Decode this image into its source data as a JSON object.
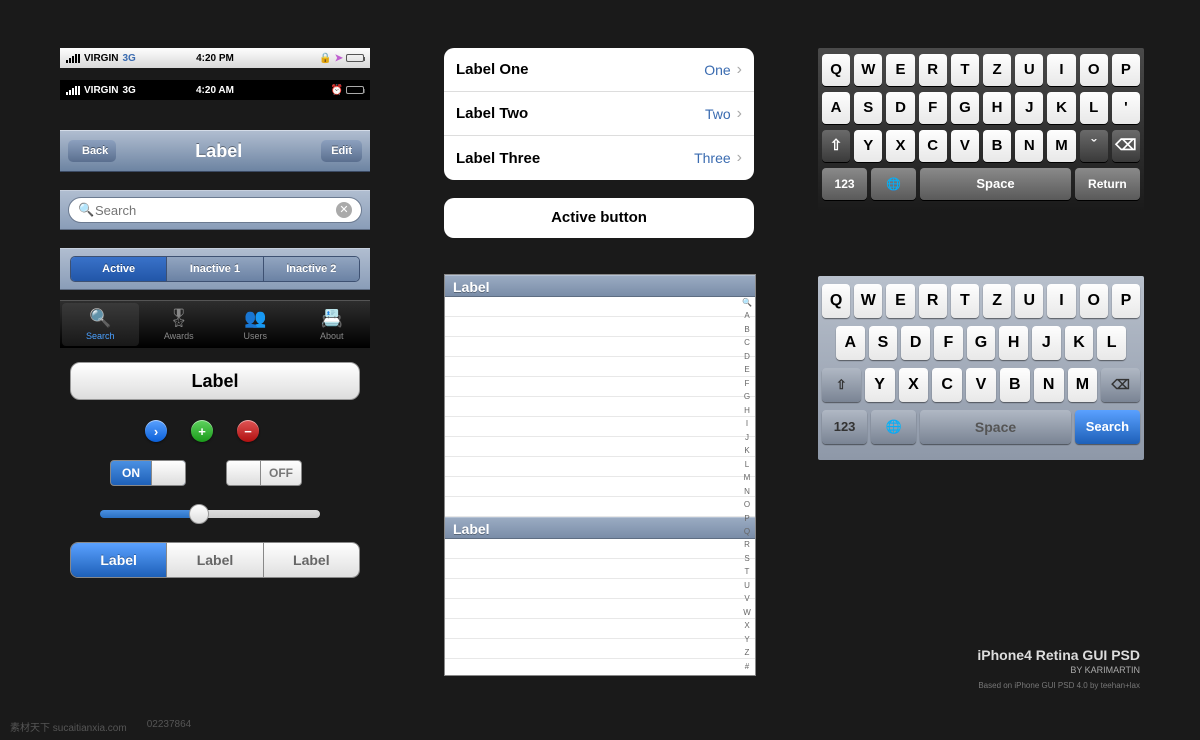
{
  "status_light": {
    "carrier": "VIRGIN",
    "network": "3G",
    "time": "4:20 PM"
  },
  "status_dark": {
    "carrier": "VIRGIN",
    "network": "3G",
    "time": "4:20 AM"
  },
  "navbar": {
    "back": "Back",
    "title": "Label",
    "edit": "Edit"
  },
  "search": {
    "placeholder": "Search"
  },
  "segmented_blue": {
    "active": "Active",
    "inactive1": "Inactive 1",
    "inactive2": "Inactive 2"
  },
  "tabbar": {
    "search": "Search",
    "awards": "Awards",
    "users": "Users",
    "about": "About"
  },
  "bigbutton": "Label",
  "toggle_on": "ON",
  "toggle_off": "OFF",
  "seg_gray": {
    "a": "Label",
    "b": "Label",
    "c": "Label"
  },
  "table": [
    {
      "label": "Label One",
      "value": "One"
    },
    {
      "label": "Label Two",
      "value": "Two"
    },
    {
      "label": "Label Three",
      "value": "Three"
    }
  ],
  "active_button": "Active button",
  "tableview": {
    "header1": "Label",
    "header2": "Label",
    "index": [
      "🔍",
      "A",
      "B",
      "C",
      "D",
      "E",
      "F",
      "G",
      "H",
      "I",
      "J",
      "K",
      "L",
      "M",
      "N",
      "O",
      "P",
      "Q",
      "R",
      "S",
      "T",
      "U",
      "V",
      "W",
      "X",
      "Y",
      "Z",
      "#"
    ]
  },
  "kb_dark": {
    "row1": [
      "Q",
      "W",
      "E",
      "R",
      "T",
      "Z",
      "U",
      "I",
      "O",
      "P"
    ],
    "row2": [
      "A",
      "S",
      "D",
      "F",
      "G",
      "H",
      "J",
      "K",
      "L",
      "'"
    ],
    "row3": [
      "⇧",
      "Y",
      "X",
      "C",
      "V",
      "B",
      "N",
      "M",
      "ˇ",
      "⌫"
    ],
    "row4": {
      "num": "123",
      "globe": "🌐",
      "space": "Space",
      "ret": "Return"
    }
  },
  "kb_light": {
    "row1": [
      "Q",
      "W",
      "E",
      "R",
      "T",
      "Z",
      "U",
      "I",
      "O",
      "P"
    ],
    "row2": [
      "A",
      "S",
      "D",
      "F",
      "G",
      "H",
      "J",
      "K",
      "L"
    ],
    "row3": [
      "⇧",
      "Y",
      "X",
      "C",
      "V",
      "B",
      "N",
      "M",
      "⌫"
    ],
    "row4": {
      "num": "123",
      "globe": "🌐",
      "space": "Space",
      "search": "Search"
    }
  },
  "attribution": {
    "title": "iPhone4 Retina GUI PSD",
    "by": "BY KARIMARTIN",
    "based": "Based on iPhone GUI PSD 4.0 by teehan+lax"
  },
  "watermark": {
    "site": "素材天下 sucaitianxia.com",
    "id": "02237864"
  }
}
